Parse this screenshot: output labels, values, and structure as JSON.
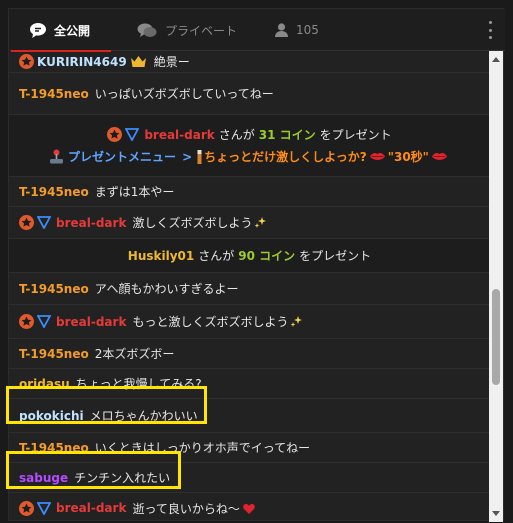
{
  "tabs": {
    "public": "全公開",
    "private": "プライベート",
    "users": "105"
  },
  "messages": [
    {
      "user": "KURIRIN4649",
      "text": "絶景ー"
    },
    {
      "user": "T-1945neo",
      "text": "いっぱいズボズボしていってねー"
    },
    {
      "gift_user": "breal-dark",
      "gift_pre": "さんが",
      "gift_amount": "31 コイン",
      "gift_post": "をプレゼント",
      "menu_label": "プレゼントメニュー",
      "menu_arrow": ">",
      "menu_item": "ちょっとだけ激しくしよっか?",
      "menu_time": "\"30秒\""
    },
    {
      "user": "T-1945neo",
      "text": "まずは1本やー"
    },
    {
      "user": "breal-dark",
      "text": "激しくズボズボしよう"
    },
    {
      "gift_user": "Huskily01",
      "gift_pre": "さんが",
      "gift_amount": "90 コイン",
      "gift_post": "をプレゼント"
    },
    {
      "user": "T-1945neo",
      "text": "アヘ顔もかわいすぎるよー"
    },
    {
      "user": "breal-dark",
      "text": "もっと激しくズボズボしよう"
    },
    {
      "user": "T-1945neo",
      "text": "2本ズボズボー"
    },
    {
      "user": "oridasu",
      "text": "ちょっと我慢してみる?"
    },
    {
      "user": "pokokichi",
      "text": "メロちゃんかわいい"
    },
    {
      "user": "T-1945neo",
      "text": "いくときはしっかりオホ声でイってねー"
    },
    {
      "user": "sabuge",
      "text": "チンチン入れたい"
    },
    {
      "user": "breal-dark",
      "text": "逝って良いからね〜"
    }
  ]
}
